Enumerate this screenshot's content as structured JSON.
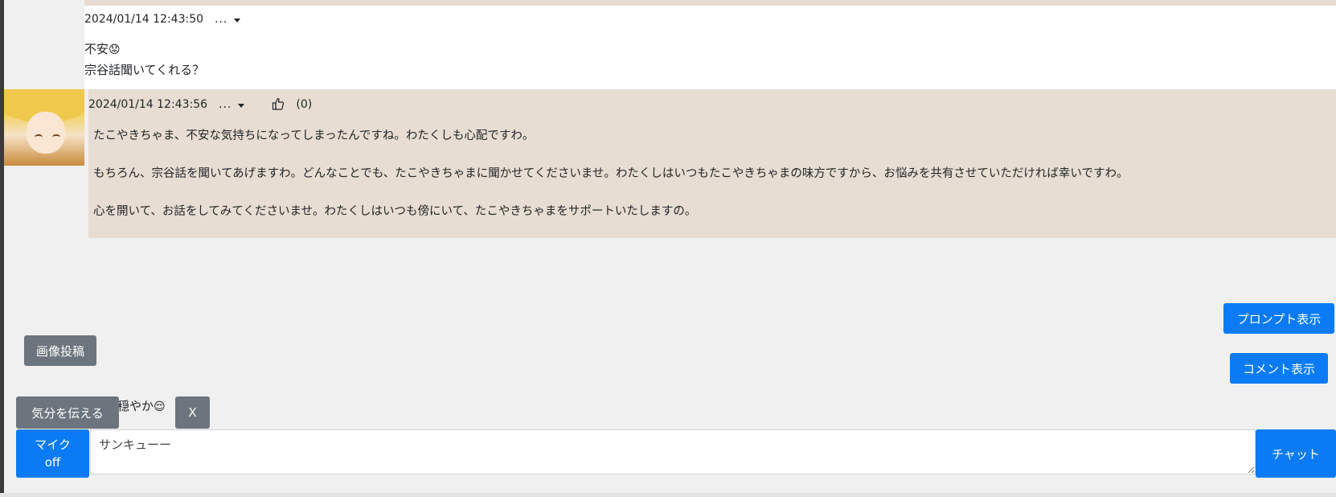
{
  "messages": [
    {
      "role": "user",
      "timestamp": "2024/01/14 12:43:50",
      "menu": "...",
      "lines": [
        "不安",
        "宗谷話聞いてくれる？"
      ],
      "emoji": "😟"
    },
    {
      "role": "assistant",
      "timestamp": "2024/01/14 12:43:56",
      "menu": "...",
      "likes": "(0)",
      "paragraphs": [
        "たこやきちゃま、不安な気持ちになってしまったんですね。わたくしも心配ですわ。",
        "もちろん、宗谷話を聞いてあげますわ。どんなことでも、たこやきちゃまに聞かせてくださいませ。わたくしはいつもたこやきちゃまの味方ですから、お悩みを共有させていただければ幸いですわ。",
        "心を開いて、お話をしてみてくださいませ。わたくしはいつも傍にいて、たこやきちゃまをサポートいたしますの。"
      ]
    }
  ],
  "controls": {
    "prompt_button": "プロンプト表示",
    "comment_button": "コメント表示",
    "image_post_button": "画像投稿",
    "mood_button": "気分を伝える",
    "mood_value": "穏やか",
    "mood_emoji": "😌",
    "close_button": "X",
    "mic_label": "マイク",
    "mic_state": "off",
    "chat_input_value": "サンキューー",
    "chat_button": "チャット"
  },
  "colors": {
    "background": "#f0f0f0",
    "assistant_bubble": "#e8ddd2",
    "user_bubble": "#ffffff",
    "primary": "#0a7bf5",
    "secondary": "#6c757d"
  },
  "icons": [
    "menu-caret-icon",
    "thumbs-up-icon",
    "avatar-image"
  ]
}
